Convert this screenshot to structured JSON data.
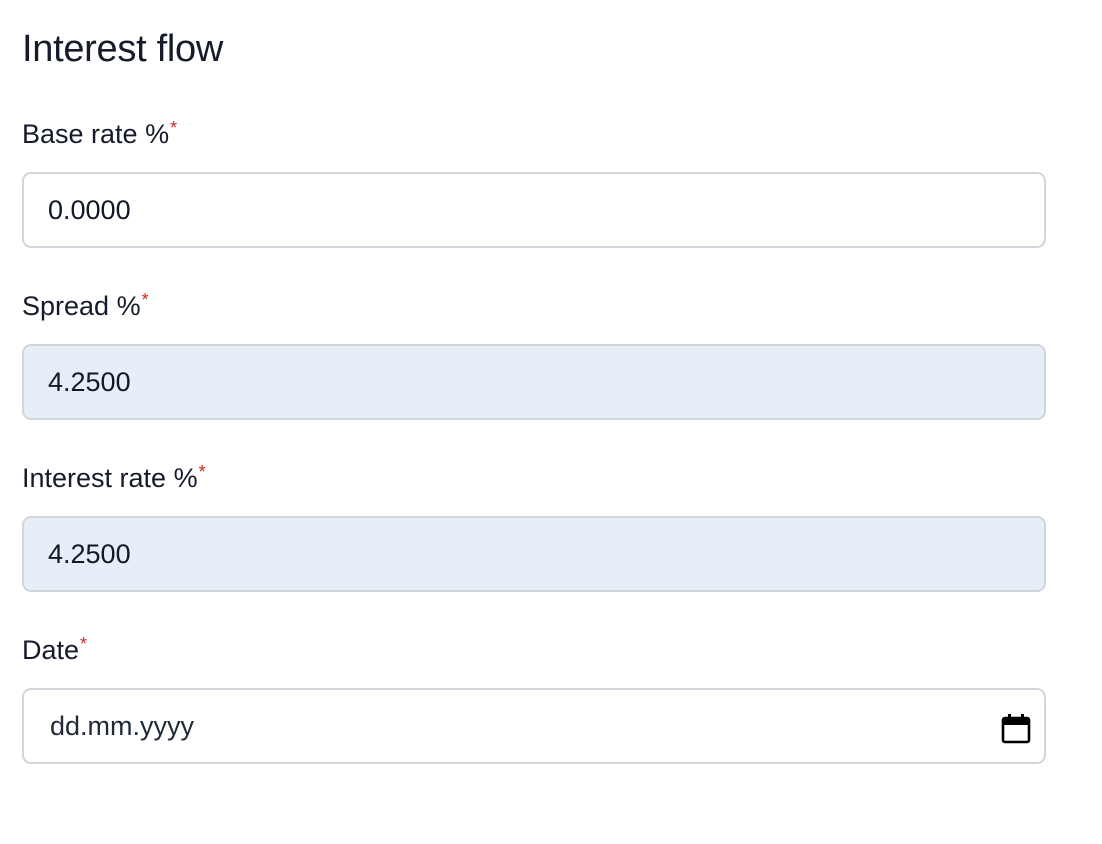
{
  "form": {
    "title": "Interest flow",
    "fields": [
      {
        "label": "Base rate %",
        "required_mark": "*",
        "value": "0.0000",
        "readonly": false
      },
      {
        "label": "Spread %",
        "required_mark": "*",
        "value": "4.2500",
        "readonly": true
      },
      {
        "label": "Interest rate %",
        "required_mark": "*",
        "value": "4.2500",
        "readonly": true
      },
      {
        "label": "Date",
        "required_mark": "*",
        "placeholder": "dd.mm.yyyy",
        "icon": "calendar-icon"
      }
    ]
  },
  "colors": {
    "required": "#c62828",
    "readonly_bg": "#e7eef8",
    "border": "#d1d5db",
    "text": "#161b2b"
  }
}
